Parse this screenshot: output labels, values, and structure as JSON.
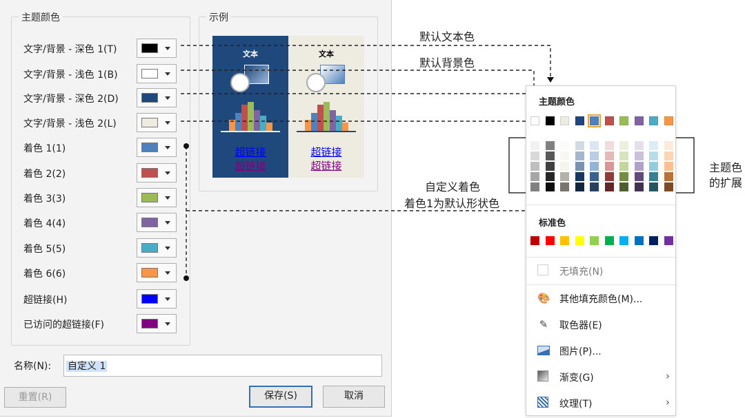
{
  "dialog": {
    "theme_group_title": "主题颜色",
    "preview_group_title": "示例",
    "rows": [
      {
        "label": "文字/背景 - 深色 1(T)",
        "color": "#000000"
      },
      {
        "label": "文字/背景 - 浅色 1(B)",
        "color": "#ffffff"
      },
      {
        "label": "文字/背景 - 深色 2(D)",
        "color": "#1f497d"
      },
      {
        "label": "文字/背景 - 浅色 2(L)",
        "color": "#eeece1"
      },
      {
        "label": "着色 1(1)",
        "color": "#4f81bd"
      },
      {
        "label": "着色 2(2)",
        "color": "#c0504d"
      },
      {
        "label": "着色 3(3)",
        "color": "#9bbb59"
      },
      {
        "label": "着色 4(4)",
        "color": "#8064a2"
      },
      {
        "label": "着色 5(5)",
        "color": "#4bacc6"
      },
      {
        "label": "着色 6(6)",
        "color": "#f79646"
      },
      {
        "label": "超链接(H)",
        "color": "#0000ff"
      },
      {
        "label": "已访问的超链接(F)",
        "color": "#800080"
      }
    ],
    "preview": {
      "text_label": "文本",
      "hyperlink": "超链接",
      "visited_hyperlink": "超链接"
    },
    "name_label": "名称(N):",
    "name_value": "自定义 1",
    "reset_label": "重置(R)",
    "save_label": "保存(S)",
    "cancel_label": "取消"
  },
  "annotations": {
    "default_text_color": "默认文本色",
    "default_bg_color": "默认背景色",
    "custom_accent_line1": "自定义着色",
    "custom_accent_line2": "着色1为默认形状色",
    "theme_extension_line1": "主题色",
    "theme_extension_line2": "的扩展"
  },
  "menu": {
    "theme_colors_title": "主题颜色",
    "theme_colors": [
      "#ffffff",
      "#000000",
      "#eeece1",
      "#1f497d",
      "#4f81bd",
      "#c0504d",
      "#9bbb59",
      "#8064a2",
      "#4bacc6",
      "#f79646"
    ],
    "standard_colors_title": "标准色",
    "standard_colors": [
      "#c00000",
      "#ff0000",
      "#ffc000",
      "#ffff00",
      "#92d050",
      "#00b050",
      "#00b0f0",
      "#0070c0",
      "#002060",
      "#7030a0"
    ],
    "no_fill": "无填充(N)",
    "more_fill_colors": "其他填充颜色(M)...",
    "eyedropper": "取色器(E)",
    "picture": "图片(P)...",
    "gradient": "渐变(G)",
    "texture": "纹理(T)"
  }
}
